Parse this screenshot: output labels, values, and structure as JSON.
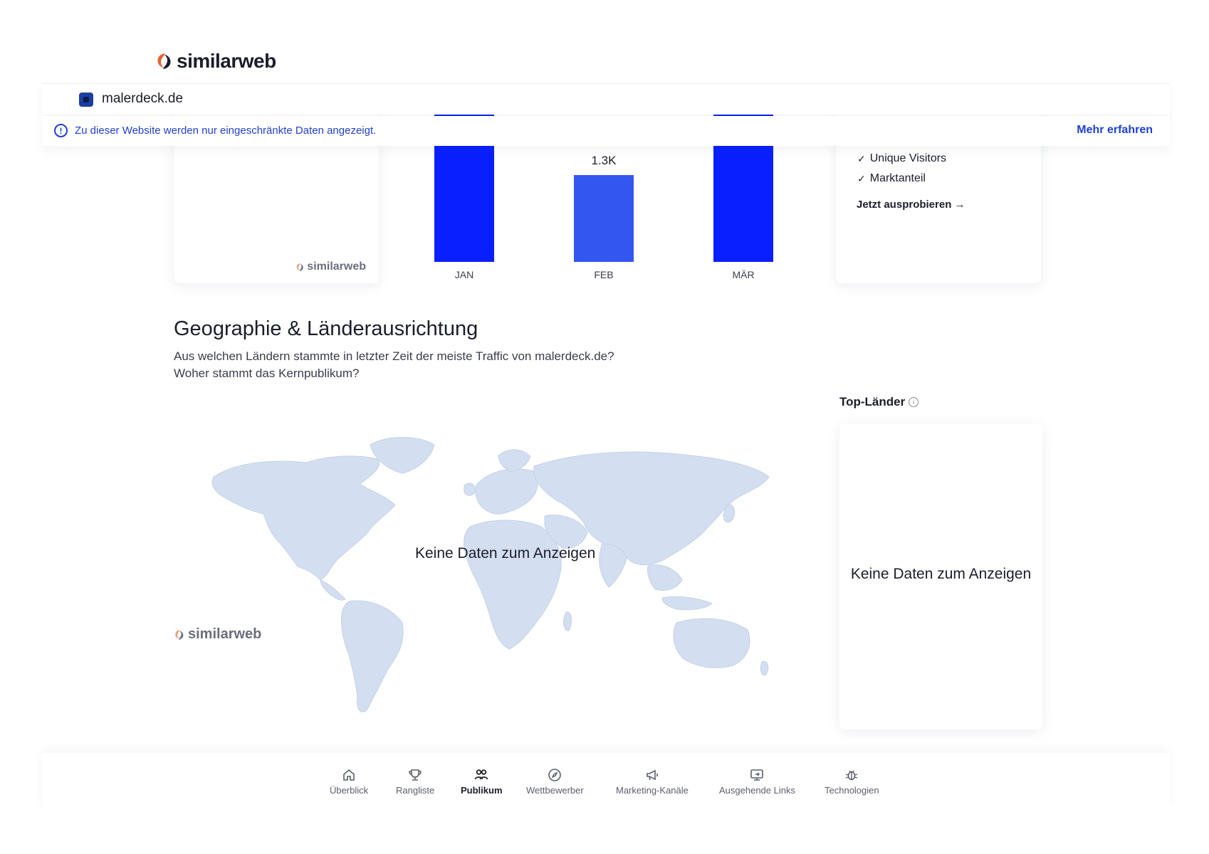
{
  "header": {
    "logo_text": "similarweb"
  },
  "domain_bar": {
    "domain": "malerdeck.de"
  },
  "banner": {
    "text": "Zu dieser Website werden nur eingeschränkte Daten angezeigt.",
    "link": "Mehr erfahren"
  },
  "left_card": {
    "watermark": "similarweb"
  },
  "right_card": {
    "items": [
      "Unique Visitors",
      "Marktanteil"
    ],
    "cta": "Jetzt ausprobieren →"
  },
  "chart_data": {
    "type": "bar",
    "categories": [
      "JAN",
      "FEB",
      "MÄR"
    ],
    "values": [
      null,
      1300,
      null
    ],
    "data_labels": [
      "",
      "1.3K",
      ""
    ],
    "colors": [
      "#0a1fff",
      "#3355f0",
      "#0a1fff"
    ]
  },
  "geo": {
    "title": "Geographie & Länderausrichtung",
    "subtitle_line1": "Aus welchen Ländern stammte in letzter Zeit der meiste Traffic von malerdeck.de?",
    "subtitle_line2": "Woher stammt das Kernpublikum?",
    "map_empty": "Keine Daten zum Anzeigen",
    "map_watermark": "similarweb",
    "top_countries_label": "Top-Länder",
    "countries_empty": "Keine Daten zum Anzeigen"
  },
  "bottom_nav": {
    "items": [
      {
        "label": "Überblick",
        "icon": "home-icon"
      },
      {
        "label": "Rangliste",
        "icon": "trophy-icon"
      },
      {
        "label": "Publikum",
        "icon": "users-icon",
        "active": true
      },
      {
        "label": "Wettbewerber",
        "icon": "compass-icon"
      },
      {
        "label": "Marketing-Kanäle",
        "icon": "megaphone-icon"
      },
      {
        "label": "Ausgehende Links",
        "icon": "monitor-link-icon"
      },
      {
        "label": "Technologien",
        "icon": "bug-icon"
      }
    ]
  },
  "colors": {
    "accent": "#1f3fd6",
    "bar_dark": "#0a1fff",
    "bar_light": "#3355f0",
    "map_land": "#d3dff0",
    "logo_orange": "#e8612c"
  }
}
